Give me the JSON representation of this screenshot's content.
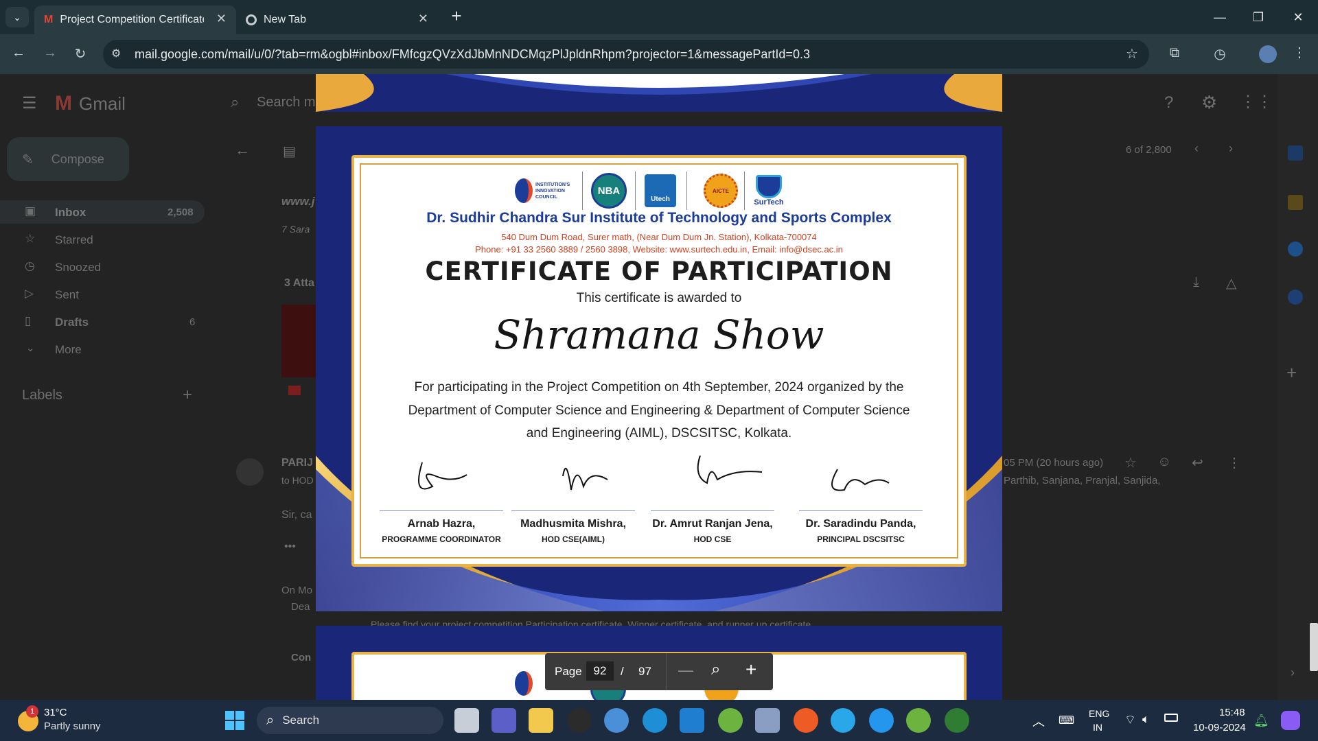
{
  "browser": {
    "tabs": [
      {
        "title": "Project Competition Certificates",
        "active": true
      },
      {
        "title": "New Tab",
        "active": false
      }
    ],
    "url": "mail.google.com/mail/u/0/?tab=rm&ogbl#inbox/FMfcgzQVzXdJbMnNDCMqzPlJpldnRhpm?projector=1&messagePartId=0.3"
  },
  "gmail": {
    "app_name": "Gmail",
    "search_placeholder": "Search m",
    "compose": "Compose",
    "nav": [
      {
        "label": "Inbox",
        "count": "2,508"
      },
      {
        "label": "Starred",
        "count": ""
      },
      {
        "label": "Snoozed",
        "count": ""
      },
      {
        "label": "Sent",
        "count": ""
      },
      {
        "label": "Drafts",
        "count": "6"
      },
      {
        "label": "More",
        "count": ""
      }
    ],
    "labels_heading": "Labels",
    "pagination": "6 of 2,800",
    "snippets": {
      "subject_start": "www.j",
      "sender_meta": "7 Sara",
      "attachments": "3 Atta",
      "sender": "PARIJ",
      "to": "to HOD",
      "body": "Sir, ca",
      "reply_intro": "On Mo",
      "dear": "Dea",
      "con": "Con",
      "time": "05 PM (20 hours ago)",
      "recipients": "Parthib, Sanjana, Pranjal, Sanjida,",
      "bottom_line": "Please find your project competition Participation certificate, Winner certificate, and runner up certificate"
    }
  },
  "certificate": {
    "logos": [
      "INSTITUTION'S INNOVATION COUNCIL",
      "NBA",
      "Utech",
      "AICTE",
      "SurTech"
    ],
    "institute": "Dr. Sudhir Chandra Sur Institute of Technology and Sports Complex",
    "address": "540 Dum Dum Road, Surer math, (Near Dum Dum Jn. Station), Kolkata-700074",
    "contact": "Phone: +91 33 2560 3889 / 2560 3898, Website: www.surtech.edu.in, Email: info@dsec.ac.in",
    "title": "CERTIFICATE OF PARTICIPATION",
    "awarded_to": "This certificate is awarded to",
    "recipient": "Shramana Show",
    "body_line1": "For participating in the Project Competition on 4th September, 2024 organized by the",
    "body_line2": "Department of Computer Science and Engineering & Department of Computer Science",
    "body_line3": "and Engineering (AIML), DSCSITSC, Kolkata.",
    "signatories": [
      {
        "name": "Arnab Hazra,",
        "role": "PROGRAMME COORDINATOR"
      },
      {
        "name": "Madhusmita Mishra,",
        "role": "HOD CSE(AIML)"
      },
      {
        "name": "Dr. Amrut Ranjan Jena,",
        "role": "HOD CSE"
      },
      {
        "name": "Dr. Saradindu Panda,",
        "role": "PRINCIPAL DSCSITSC"
      }
    ]
  },
  "pdf_toolbar": {
    "page_label": "Page",
    "current_page": "92",
    "separator": "/",
    "total_pages": "97"
  },
  "taskbar": {
    "weather_temp": "31°C",
    "weather_desc": "Partly sunny",
    "weather_badge": "1",
    "search": "Search",
    "lang_top": "ENG",
    "lang_bottom": "IN",
    "time": "15:48",
    "date": "10-09-2024"
  }
}
